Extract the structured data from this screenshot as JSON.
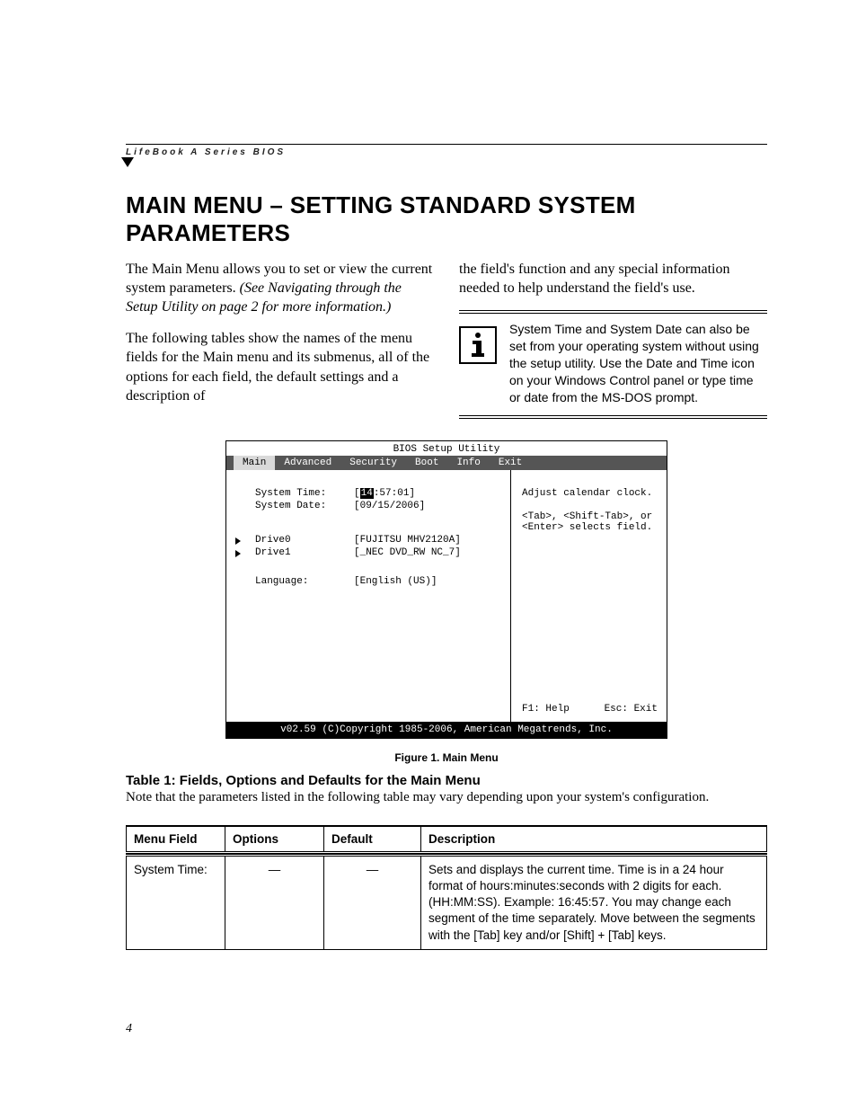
{
  "running_head": "LifeBook A Series BIOS",
  "heading": "MAIN MENU – SETTING STANDARD SYSTEM PARAMETERS",
  "intro": {
    "p1a": "The Main Menu allows you to set or view the current system parameters. ",
    "p1b": "(See Navigating through the Setup Utility on page 2 for more information.)",
    "p2": "The following tables show the names of the menu fields for the Main menu and its submenus, all of the options for each field, the default settings and a description of",
    "p3": "the field's function and any special information needed to help understand the field's use."
  },
  "note": "System Time and System Date can also be set from your operating system without using the setup utility. Use the Date and Time icon on your Windows Control panel or type time or date from the MS-DOS prompt.",
  "bios": {
    "title": "BIOS Setup Utility",
    "tabs": [
      "Main",
      "Advanced",
      "Security",
      "Boot",
      "Info",
      "Exit"
    ],
    "active_tab": "Main",
    "rows": {
      "system_time_label": "System Time:",
      "system_time_prefix": "[",
      "system_time_hh": "14",
      "system_time_rest": ":57:01]",
      "system_date_label": "System Date:",
      "system_date_value": "[09/15/2006]",
      "drive0_label": "Drive0",
      "drive0_value": "[FUJITSU MHV2120A]",
      "drive1_label": "Drive1",
      "drive1_value": "[_NEC DVD_RW NC_7]",
      "language_label": "Language:",
      "language_value": "[English (US)]"
    },
    "help": {
      "line1": "Adjust calendar clock.",
      "line2": "<Tab>, <Shift-Tab>, or <Enter> selects field.",
      "f1": "F1: Help",
      "esc": "Esc: Exit"
    },
    "footer": "v02.59 (C)Copyright 1985-2006, American Megatrends, Inc."
  },
  "fig_caption": "Figure 1.  Main Menu",
  "table": {
    "title": "Table 1: Fields, Options and Defaults for the Main Menu",
    "note": "Note that the parameters listed in the following table may vary depending upon your system's configuration.",
    "headers": [
      "Menu Field",
      "Options",
      "Default",
      "Description"
    ],
    "rows": [
      {
        "field": "System Time:",
        "options": "—",
        "default": "—",
        "description": "Sets and displays the current time. Time is in a 24 hour format of hours:minutes:seconds with 2 digits for each. (HH:MM:SS). Example: 16:45:57. You may change each segment of the time separately. Move between the segments with the [Tab] key and/or [Shift] + [Tab] keys."
      }
    ]
  },
  "page_number": "4"
}
